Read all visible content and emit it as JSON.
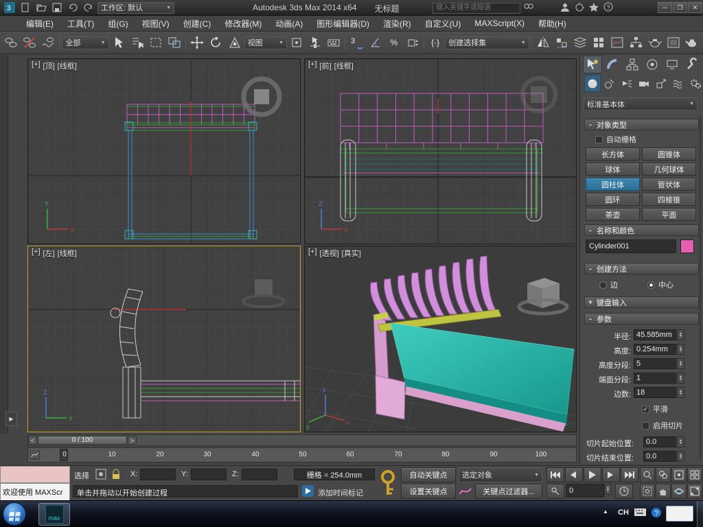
{
  "titlebar": {
    "workspace": "工作区: 默认",
    "app_title": "Autodesk 3ds Max  2014 x64",
    "doc_title": "无标题",
    "search_placeholder": "键入关键字或短语"
  },
  "menu": {
    "items": [
      "编辑(E)",
      "工具(T)",
      "组(G)",
      "视图(V)",
      "创建(C)",
      "修改器(M)",
      "动画(A)",
      "图形编辑器(D)",
      "渲染(R)",
      "自定义(U)",
      "MAXScript(X)",
      "帮助(H)"
    ]
  },
  "toolbar": {
    "selection_filter": "全部",
    "coord_system": "视图",
    "named_sets_placeholder": "创建选择集",
    "snap_label": "3",
    "percent_label": "%"
  },
  "viewports": {
    "top_left": {
      "menu": "[+]",
      "view": "[顶]",
      "shading": "[线框]"
    },
    "top_right": {
      "menu": "[+]",
      "view": "[前]",
      "shading": "[线框]"
    },
    "bottom_left": {
      "menu": "[+]",
      "view": "[左]",
      "shading": "[线框]"
    },
    "bottom_right": {
      "menu": "[+]",
      "view": "[透视]",
      "shading": "[真实]"
    }
  },
  "command_panel": {
    "object_dropdown": "标准基本体",
    "object_type": {
      "sign": "-",
      "title": "对象类型",
      "autogrid": "自动栅格",
      "buttons": [
        "长方体",
        "圆锥体",
        "球体",
        "几何球体",
        "圆柱体",
        "管状体",
        "圆环",
        "四棱锥",
        "茶壶",
        "平面"
      ]
    },
    "name_color": {
      "sign": "-",
      "title": "名称和颜色",
      "name": "Cylinder001",
      "swatch_color": "#e55fb2"
    },
    "creation_method": {
      "sign": "-",
      "title": "创建方法",
      "edge": "边",
      "center": "中心"
    },
    "keyboard_entry": {
      "sign": "+",
      "title": "键盘输入"
    },
    "parameters": {
      "sign": "-",
      "title": "参数",
      "fields": [
        {
          "label": "半径:",
          "value": "45.585mm"
        },
        {
          "label": "高度:",
          "value": "0.254mm"
        },
        {
          "label": "高度分段:",
          "value": "5"
        },
        {
          "label": "端面分段:",
          "value": "1"
        },
        {
          "label": "边数:",
          "value": "18"
        }
      ],
      "smooth": "平滑",
      "enable_slice": "启用切片",
      "slice_from": {
        "label": "切片起始位置:",
        "value": "0.0"
      },
      "slice_to": {
        "label": "切片结束位置:",
        "value": "0.0"
      }
    }
  },
  "timeline": {
    "slider": "0 / 100",
    "ticks": [
      "0",
      "10",
      "20",
      "30",
      "40",
      "50",
      "60",
      "70",
      "80",
      "90",
      "100"
    ]
  },
  "statusbar": {
    "welcome": "欢迎使用 MAXScr",
    "selection_label": "选择",
    "x": "X:",
    "y": "Y:",
    "z": "Z:",
    "grid": "栅格 = 254.0mm",
    "prompt": "单击并拖动以开始创建过程",
    "add_time_tag": "添加时间标记",
    "auto_key": "自动关键点",
    "set_key": "设置关键点",
    "selected_filter": "选定对象",
    "key_filters": "关键点过滤器...",
    "frame": "0"
  },
  "taskbar": {
    "lang": "CH",
    "app_label": "max"
  },
  "icons": {
    "caret": "▼",
    "minimize": "─",
    "maximize": "❐",
    "close": "✕",
    "left": "<",
    "right": ">",
    "flyout": "▶",
    "check": "✓",
    "up": "▲",
    "down": "▼"
  }
}
